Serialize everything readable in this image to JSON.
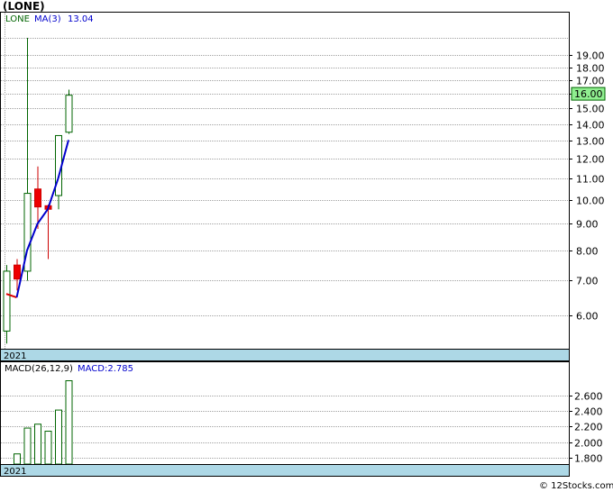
{
  "title": "(LONE)",
  "credit": "© 12Stocks.com",
  "chart_data": [
    {
      "type": "candlestick",
      "legend": {
        "symbol": "LONE",
        "ma_label": "MA(3)",
        "ma_value": "13.04"
      },
      "price_tag": "16.00",
      "year_label": "2021",
      "y_scale": "log",
      "ylim": [
        5.2,
        21.5
      ],
      "yticks": [
        6.0,
        7.0,
        8.0,
        9.0,
        10.0,
        11.0,
        12.0,
        13.0,
        14.0,
        15.0,
        16.0,
        17.0,
        18.0,
        19.0
      ],
      "grid": true,
      "candles": [
        {
          "open": 5.6,
          "high": 7.5,
          "low": 5.3,
          "close": 7.3
        },
        {
          "open": 7.5,
          "high": 7.7,
          "low": 6.7,
          "close": 7.05
        },
        {
          "open": 7.3,
          "high": 20.5,
          "low": 7.0,
          "close": 10.3
        },
        {
          "open": 10.5,
          "high": 11.6,
          "low": 8.8,
          "close": 9.7
        },
        {
          "open": 9.75,
          "high": 9.8,
          "low": 7.7,
          "close": 9.6
        },
        {
          "open": 10.2,
          "high": 13.3,
          "low": 9.6,
          "close": 13.3
        },
        {
          "open": 13.5,
          "high": 16.3,
          "low": 13.4,
          "close": 15.9
        }
      ],
      "ma": [
        6.6,
        6.5,
        8.0,
        9.0,
        9.6,
        11.0,
        13.04
      ]
    },
    {
      "type": "bar",
      "legend": {
        "label": "MACD(26,12,9)",
        "value_label": "MACD:2.785"
      },
      "year_label": "2021",
      "ylim": [
        1.72,
        2.86
      ],
      "yticks": [
        1.8,
        2.0,
        2.2,
        2.4,
        2.6
      ],
      "values": [
        1.72,
        1.85,
        2.18,
        2.23,
        2.14,
        2.41,
        2.785
      ]
    }
  ]
}
